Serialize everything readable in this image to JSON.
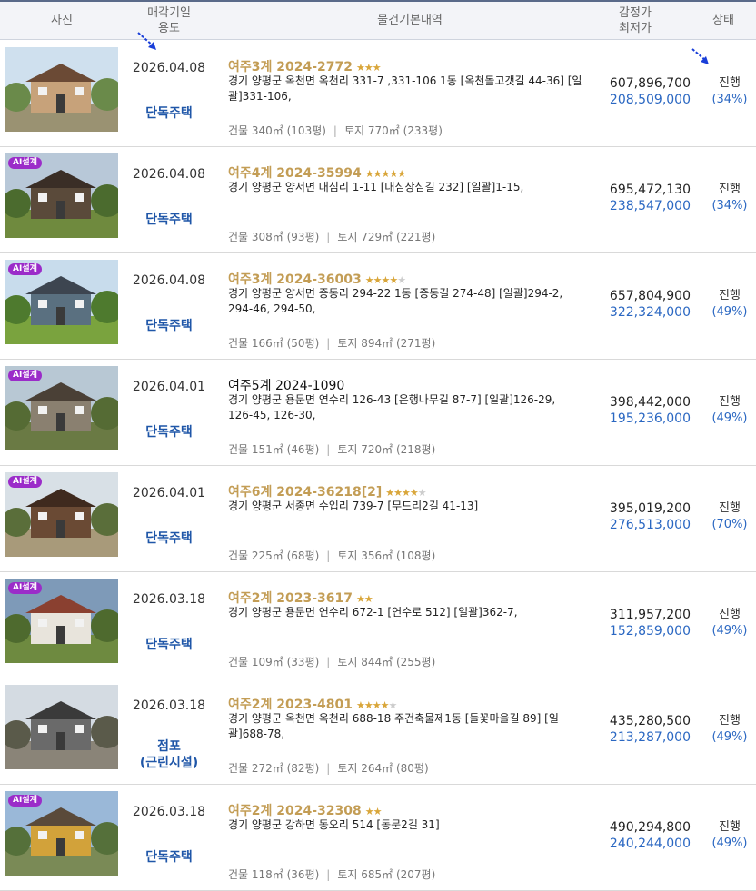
{
  "header": {
    "photo": "사진",
    "date_line1": "매각기일",
    "date_line2": "용도",
    "desc": "물건기본내역",
    "price_line1": "감정가",
    "price_line2": "최저가",
    "status": "상태"
  },
  "colors": {
    "accent_case": "#c39d55",
    "usage_blue": "#1f56a8",
    "price_blue": "#2a67c2",
    "ai_badge": "#9b2cc9"
  },
  "ai_badge_label": "AI설계",
  "rows": [
    {
      "date": "2026.04.08",
      "usage": "단독주택",
      "case": "여주3계 2024-2772",
      "stars": 2.5,
      "addr": "경기 양평군 옥천면 옥천리 331-7 ,331-106 1동 [옥천돌고갯길 44-36] [일괄]331-106,",
      "area_building": "건물 340㎡ (103평)",
      "area_land": "토지 770㎡ (233평)",
      "appraisal": "607,896,700",
      "minimum": "208,509,000",
      "status": "진행",
      "pct": "(34%)",
      "ai": false
    },
    {
      "date": "2026.04.08",
      "usage": "단독주택",
      "case": "여주4계 2024-35994",
      "stars": 5,
      "addr": "경기 양평군 양서면 대심리 1-11 [대심상심길 232] [일괄]1-15,",
      "area_building": "건물 308㎡ (93평)",
      "area_land": "토지 729㎡ (221평)",
      "appraisal": "695,472,130",
      "minimum": "238,547,000",
      "status": "진행",
      "pct": "(34%)",
      "ai": true
    },
    {
      "date": "2026.04.08",
      "usage": "단독주택",
      "case": "여주3계 2024-36003",
      "stars": 4,
      "addr": "경기 양평군 양서면 증동리 294-22 1동 [증동길 274-48] [일괄]294-2, 294-46, 294-50,",
      "area_building": "건물 166㎡ (50평)",
      "area_land": "토지 894㎡ (271평)",
      "appraisal": "657,804,900",
      "minimum": "322,324,000",
      "status": "진행",
      "pct": "(49%)",
      "ai": true
    },
    {
      "date": "2026.04.01",
      "usage": "단독주택",
      "case": "여주5계 2024-1090",
      "stars": 0,
      "addr": "경기 양평군 용문면 연수리 126-43 [은행나무길 87-7] [일괄]126-29, 126-45, 126-30,",
      "area_building": "건물 151㎡ (46평)",
      "area_land": "토지 720㎡ (218평)",
      "appraisal": "398,442,000",
      "minimum": "195,236,000",
      "status": "진행",
      "pct": "(49%)",
      "ai": true
    },
    {
      "date": "2026.04.01",
      "usage": "단독주택",
      "case": "여주6계 2024-36218[2]",
      "stars": 4,
      "addr": "경기 양평군 서종면 수입리 739-7 [무드리2길 41-13]",
      "area_building": "건물 225㎡ (68평)",
      "area_land": "토지 356㎡ (108평)",
      "appraisal": "395,019,200",
      "minimum": "276,513,000",
      "status": "진행",
      "pct": "(70%)",
      "ai": true
    },
    {
      "date": "2026.03.18",
      "usage": "단독주택",
      "case": "여주2계 2023-3617",
      "stars": 1.5,
      "addr": "경기 양평군 용문면 연수리 672-1 [연수로 512] [일괄]362-7,",
      "area_building": "건물 109㎡ (33평)",
      "area_land": "토지 844㎡ (255평)",
      "appraisal": "311,957,200",
      "minimum": "152,859,000",
      "status": "진행",
      "pct": "(49%)",
      "ai": true
    },
    {
      "date": "2026.03.18",
      "usage": "점포\n(근린시설)",
      "case": "여주2계 2023-4801",
      "stars": 4,
      "addr": "경기 양평군 옥천면 옥천리 688-18 주건축물제1동 [들꽃마을길 89] [일괄]688-78,",
      "area_building": "건물 272㎡ (82평)",
      "area_land": "토지 264㎡ (80평)",
      "appraisal": "435,280,500",
      "minimum": "213,287,000",
      "status": "진행",
      "pct": "(49%)",
      "ai": false
    },
    {
      "date": "2026.03.18",
      "usage": "단독주택",
      "case": "여주2계 2024-32308",
      "stars": 1.5,
      "addr": "경기 양평군 강하면 동오리 514 [동문2길 31]",
      "area_building": "건물 118㎡ (36평)",
      "area_land": "토지 685㎡ (207평)",
      "appraisal": "490,294,800",
      "minimum": "240,244,000",
      "status": "진행",
      "pct": "(49%)",
      "ai": true
    }
  ]
}
